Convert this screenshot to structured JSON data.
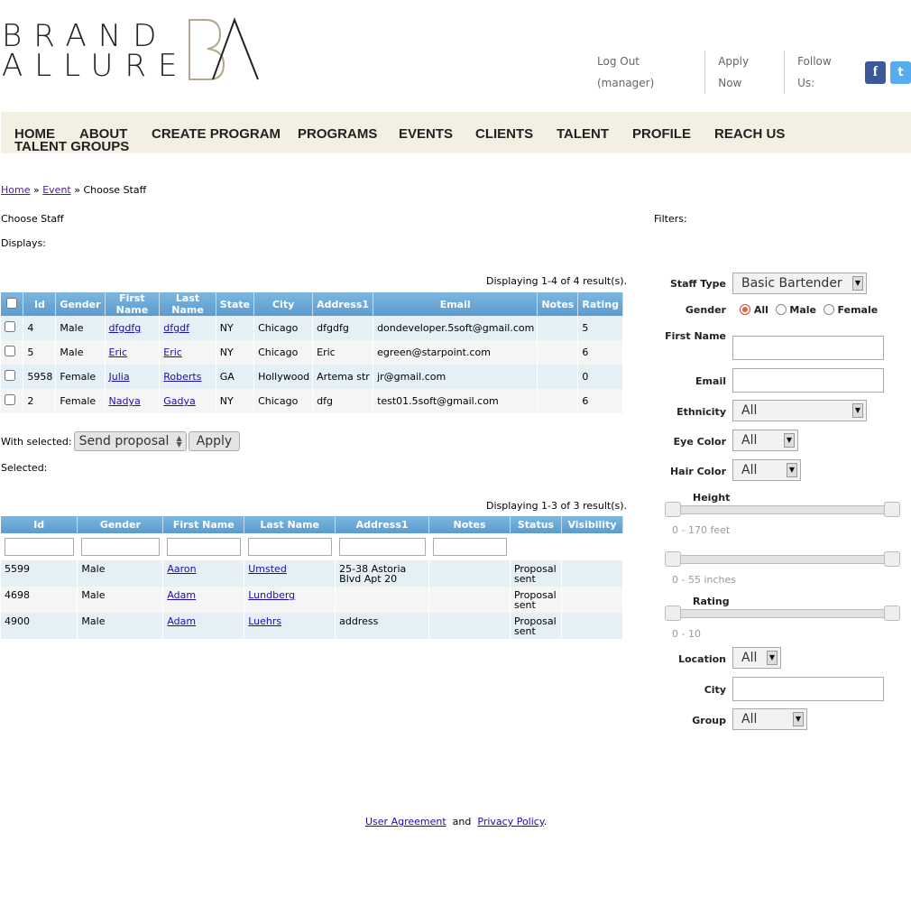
{
  "brand": {
    "line1": "BRAND",
    "line2": "ALLURE",
    "mark": "BA"
  },
  "top_links": {
    "logout": "Log Out (manager)",
    "apply": "Apply Now",
    "follow": "Follow Us:",
    "facebook_glyph": "f",
    "twitter_glyph": "t"
  },
  "nav": [
    "HOME",
    "ABOUT",
    "CREATE PROGRAM",
    "PROGRAMS",
    "EVENTS",
    "CLIENTS",
    "TALENT",
    "PROFILE",
    "REACH US",
    "TALENT GROUPS"
  ],
  "breadcrumb": {
    "home": "Home",
    "sep1": " » ",
    "event": "Event",
    "sep2": " » ",
    "current": "Choose Staff"
  },
  "labels": {
    "choose_staff": "Choose Staff",
    "displays": "Displays:",
    "filters": "Filters:",
    "with_selected": "With selected:",
    "selected": "Selected:"
  },
  "table1": {
    "summary": "Displaying 1-4 of 4 result(s).",
    "columns": [
      "Id",
      "Gender",
      "First Name",
      "Last Name",
      "State",
      "City",
      "Address1",
      "Email",
      "Notes",
      "Rating"
    ],
    "rows": [
      {
        "id": "4",
        "gender": "Male",
        "first": "dfgdfg",
        "last": "dfgdf",
        "state": "NY",
        "city": "Chicago",
        "address": "dfgdfg",
        "email": "dondeveloper.5soft@gmail.com",
        "notes": "",
        "rating": "5"
      },
      {
        "id": "5",
        "gender": "Male",
        "first": "Eric",
        "last": "Eric",
        "state": "NY",
        "city": "Chicago",
        "address": "Eric",
        "email": "egreen@starpoint.com",
        "notes": "",
        "rating": "6"
      },
      {
        "id": "5958",
        "gender": "Female",
        "first": "Julia",
        "last": "Roberts",
        "state": "GA",
        "city": "Hollywood",
        "address": "Artema str",
        "email": "jr@gmail.com",
        "notes": "",
        "rating": "0"
      },
      {
        "id": "2",
        "gender": "Female",
        "first": "Nadya",
        "last": "Gadya",
        "state": "NY",
        "city": "Chicago",
        "address": "dfg",
        "email": "test01.5soft@gmail.com",
        "notes": "",
        "rating": "6"
      }
    ]
  },
  "bulk": {
    "action": "Send proposal",
    "apply": "Apply"
  },
  "table2": {
    "summary": "Displaying 1-3 of 3 result(s).",
    "columns": [
      "Id",
      "Gender",
      "First Name",
      "Last Name",
      "Address1",
      "Notes",
      "Status",
      "Visibility"
    ],
    "rows": [
      {
        "id": "5599",
        "gender": "Male",
        "first": "Aaron",
        "last": "Umsted",
        "address": "25-38 Astoria Blvd Apt 20",
        "notes": "",
        "status": "Proposal sent",
        "visibility": ""
      },
      {
        "id": "4698",
        "gender": "Male",
        "first": "Adam",
        "last": "Lundberg",
        "address": "",
        "notes": "",
        "status": "Proposal sent",
        "visibility": ""
      },
      {
        "id": "4900",
        "gender": "Male",
        "first": "Adam",
        "last": "Luehrs",
        "address": "address",
        "notes": "",
        "status": "Proposal sent",
        "visibility": ""
      }
    ]
  },
  "filters": {
    "staff_type": {
      "label": "Staff Type",
      "value": "Basic Bartender"
    },
    "gender": {
      "label": "Gender",
      "options": [
        "All",
        "Male",
        "Female"
      ],
      "selected": "All"
    },
    "first_name": {
      "label": "First Name",
      "value": ""
    },
    "email": {
      "label": "Email",
      "value": ""
    },
    "ethnicity": {
      "label": "Ethnicity",
      "value": "All"
    },
    "eye_color": {
      "label": "Eye Color",
      "value": "All"
    },
    "hair_color": {
      "label": "Hair Color",
      "value": "All"
    },
    "height": {
      "label": "Height",
      "feet_hint": "0 - 170 feet",
      "inches_hint": "0 - 55 inches"
    },
    "rating": {
      "label": "Rating",
      "hint": "0 - 10"
    },
    "location": {
      "label": "Location",
      "value": "All"
    },
    "city": {
      "label": "City",
      "value": ""
    },
    "group": {
      "label": "Group",
      "value": "All"
    }
  },
  "footer": {
    "agreement": "User Agreement",
    "and": "and",
    "privacy": "Privacy Policy",
    "end": "."
  }
}
